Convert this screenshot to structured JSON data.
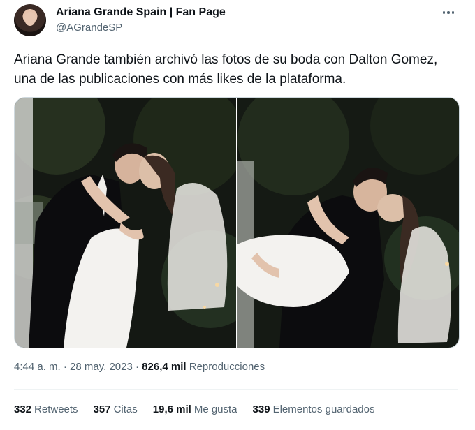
{
  "tweet": {
    "author_name": "Ariana Grande Spain | Fan Page",
    "author_handle": "@AGrandeSP",
    "text": "Ariana Grande también archivó las fotos de su boda con Dalton Gomez, una de las publicaciones con más likes de la plataforma.",
    "time": "4:44 a. m.",
    "separator": "·",
    "date": "28 may. 2023",
    "views_count": "826,4 mil",
    "views_label": "Reproducciones",
    "images": [
      {
        "icon": "wedding-photo-kiss"
      },
      {
        "icon": "wedding-photo-dip"
      }
    ]
  },
  "stats": {
    "retweets_count": "332",
    "retweets_label": "Retweets",
    "quotes_count": "357",
    "quotes_label": "Citas",
    "likes_count": "19,6 mil",
    "likes_label": "Me gusta",
    "bookmarks_count": "339",
    "bookmarks_label": "Elementos guardados"
  },
  "colors": {
    "text": "#0f1419",
    "secondary": "#536471",
    "border": "#cfd9de"
  }
}
